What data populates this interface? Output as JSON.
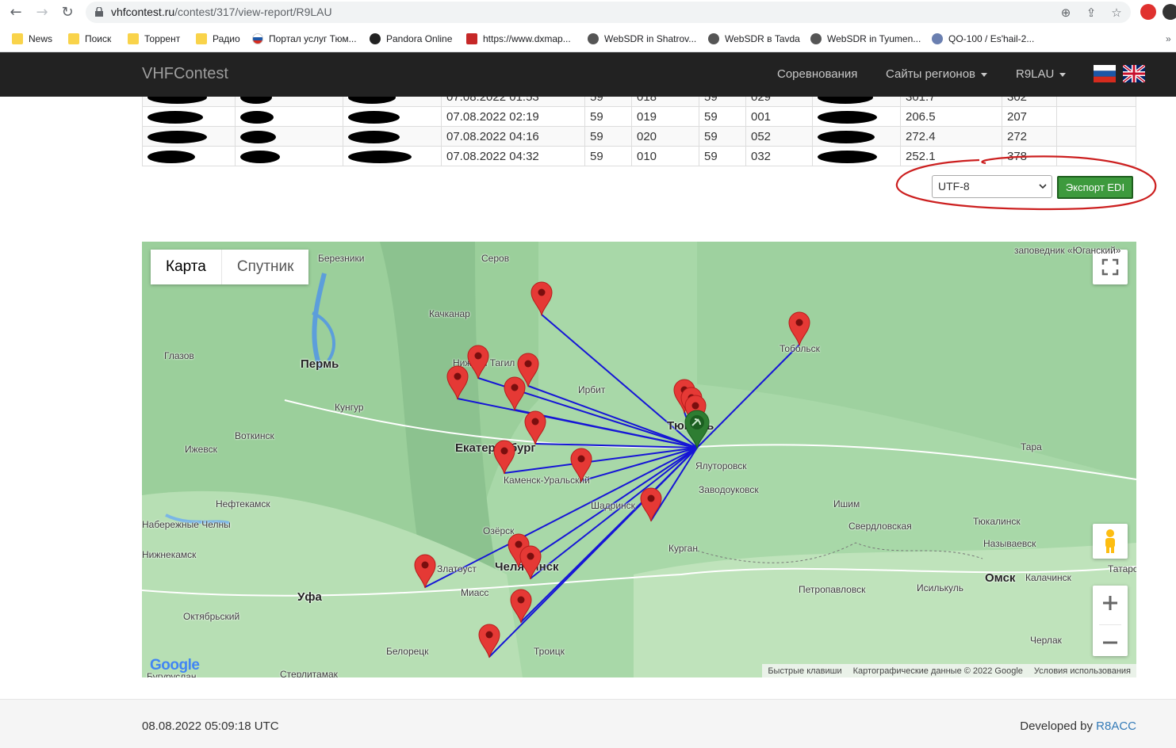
{
  "browser": {
    "url_host": "vhfcontest.ru",
    "url_path": "/contest/317/view-report/R9LAU",
    "bookmarks": [
      {
        "label": "News",
        "icon": "folder-icon"
      },
      {
        "label": "Поиск",
        "icon": "folder-icon"
      },
      {
        "label": "Торрент",
        "icon": "folder-icon"
      },
      {
        "label": "Радио",
        "icon": "folder-icon"
      },
      {
        "label": "Портал услуг Тюм...",
        "icon": "russia-icon"
      },
      {
        "label": "Pandora Online",
        "icon": "pandora-icon"
      },
      {
        "label": "https://www.dxmap...",
        "icon": "dxmap-icon"
      },
      {
        "label": "WebSDR in Shatrov...",
        "icon": "globe-icon"
      },
      {
        "label": "WebSDR в Tavda",
        "icon": "globe-icon"
      },
      {
        "label": "WebSDR in Tyumen...",
        "icon": "globe-icon"
      },
      {
        "label": "QO-100 / Es'hail-2...",
        "icon": "satellite-icon"
      }
    ]
  },
  "navbar": {
    "brand": "VHFContest",
    "links": [
      "Соревнования",
      "Сайты регионов",
      "R9LAU"
    ]
  },
  "table": {
    "rows": [
      {
        "time": "07.08.2022 01:53",
        "rst_s": "59",
        "nr_s": "018",
        "rst_r": "59",
        "nr_r": "029",
        "dist": "301.7",
        "pts": "302"
      },
      {
        "time": "07.08.2022 02:19",
        "rst_s": "59",
        "nr_s": "019",
        "rst_r": "59",
        "nr_r": "001",
        "dist": "206.5",
        "pts": "207"
      },
      {
        "time": "07.08.2022 04:16",
        "rst_s": "59",
        "nr_s": "020",
        "rst_r": "59",
        "nr_r": "052",
        "dist": "272.4",
        "pts": "272"
      },
      {
        "time": "07.08.2022 04:32",
        "rst_s": "59",
        "nr_s": "010",
        "rst_r": "59",
        "nr_r": "032",
        "dist": "252.1",
        "pts": "378"
      }
    ]
  },
  "export": {
    "encoding": "UTF-8",
    "button": "Экспорт EDI"
  },
  "map": {
    "type_map": "Карта",
    "type_satellite": "Спутник",
    "cities": [
      {
        "name": "Березники",
        "big": false
      },
      {
        "name": "Серов",
        "big": false
      },
      {
        "name": "Качканар",
        "big": false
      },
      {
        "name": "Пермь",
        "big": true
      },
      {
        "name": "Глазов",
        "big": false
      },
      {
        "name": "Кунгур",
        "big": false
      },
      {
        "name": "Ирбит",
        "big": false
      },
      {
        "name": "Тобольск",
        "big": false
      },
      {
        "name": "Воткинск",
        "big": false
      },
      {
        "name": "Ижевск",
        "big": false
      },
      {
        "name": "Екатеринбург",
        "big": true
      },
      {
        "name": "Тюмень",
        "big": true
      },
      {
        "name": "Ялуторовск",
        "big": false
      },
      {
        "name": "Каменск-Уральский",
        "big": false
      },
      {
        "name": "Заводоуковск",
        "big": false
      },
      {
        "name": "Тара",
        "big": false
      },
      {
        "name": "Нефтекамск",
        "big": false
      },
      {
        "name": "Шадринск",
        "big": false
      },
      {
        "name": "Ишим",
        "big": false
      },
      {
        "name": "Набережные Челны",
        "big": false
      },
      {
        "name": "Озёрск",
        "big": false
      },
      {
        "name": "Свердловская",
        "big": false
      },
      {
        "name": "Тюкалинск",
        "big": false
      },
      {
        "name": "Курган",
        "big": false
      },
      {
        "name": "Называевск",
        "big": false
      },
      {
        "name": "Нижнекамск",
        "big": false
      },
      {
        "name": "Златоуст",
        "big": false
      },
      {
        "name": "Челябинск",
        "big": true
      },
      {
        "name": "Татарск",
        "big": false
      },
      {
        "name": "Омск",
        "big": true
      },
      {
        "name": "Калачинск",
        "big": false
      },
      {
        "name": "Уфа",
        "big": true
      },
      {
        "name": "Миасс",
        "big": false
      },
      {
        "name": "Петропавловск",
        "big": false
      },
      {
        "name": "Исилькуль",
        "big": false
      },
      {
        "name": "Октябрьский",
        "big": false
      },
      {
        "name": "Белорецк",
        "big": false
      },
      {
        "name": "Троицк",
        "big": false
      },
      {
        "name": "Черлак",
        "big": false
      },
      {
        "name": "Бугуруслан",
        "big": false
      },
      {
        "name": "Стерлитамак",
        "big": false
      },
      {
        "name": "Нижний Тагил",
        "big": false
      },
      {
        "name": "заповедник «Юганский»",
        "big": false
      }
    ],
    "attribution": [
      "Быстрые клавиши",
      "Картографические данные © 2022 Google",
      "Условия использования"
    ],
    "logo": "Google"
  },
  "footer": {
    "timestamp": "08.08.2022 05:09:18 UTC",
    "developed_by": "Developed by",
    "developer": "R8ACC"
  }
}
